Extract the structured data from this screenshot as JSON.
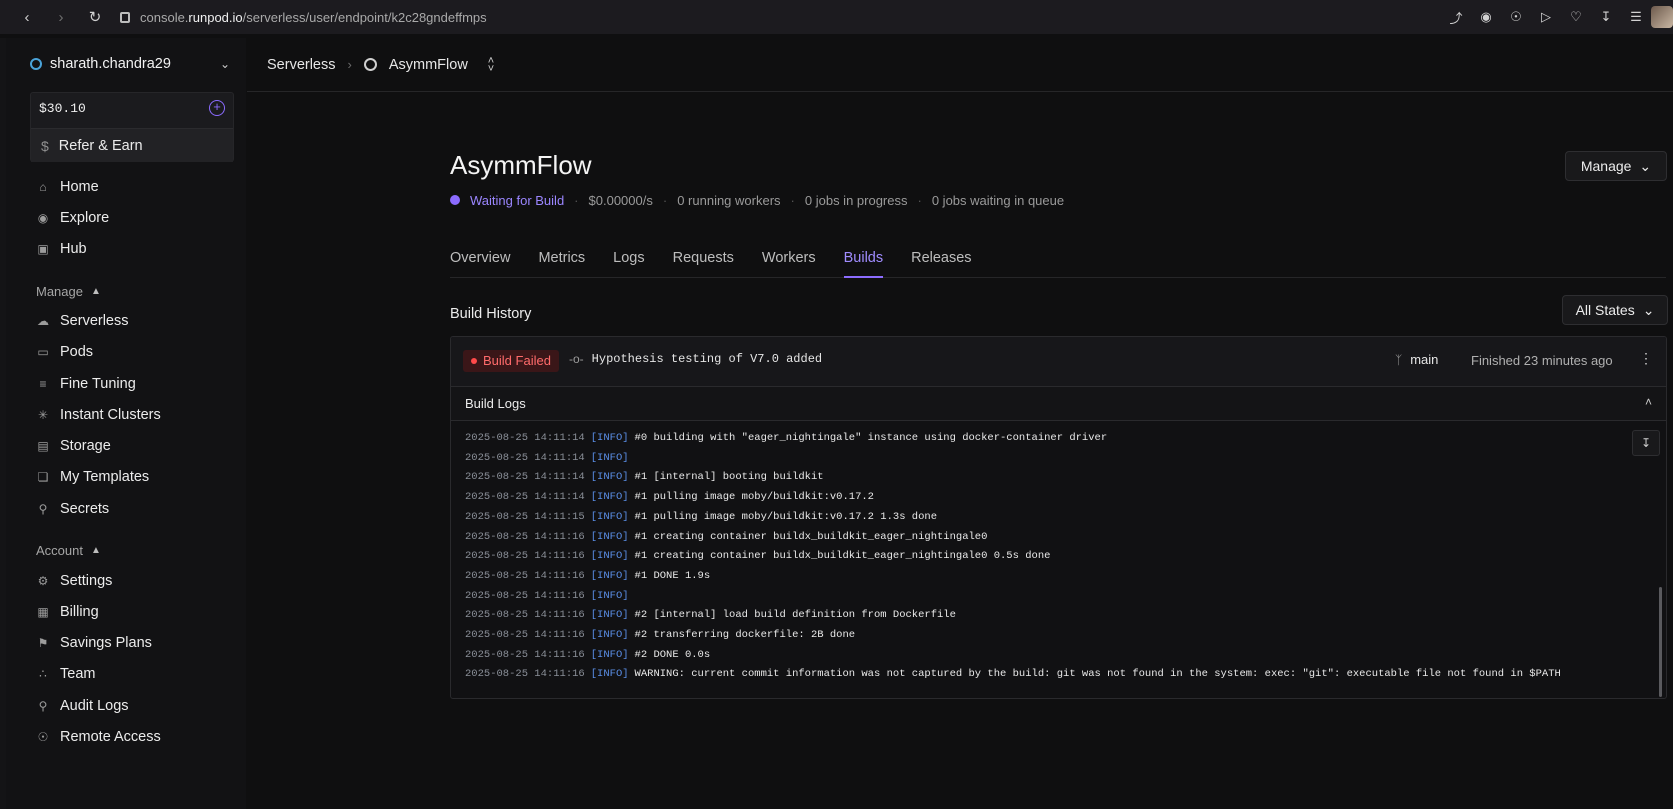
{
  "browser": {
    "url_prefix": "console.",
    "url_host": "runpod.io",
    "url_path": "/serverless/user/endpoint/k2c28gndeffmps"
  },
  "sidebar": {
    "account_name": "sharath.chandra29",
    "balance": "$30.10",
    "refer_label": "Refer & Earn",
    "top_items": [
      {
        "label": "Home",
        "icon": "home-icon"
      },
      {
        "label": "Explore",
        "icon": "compass-icon"
      },
      {
        "label": "Hub",
        "icon": "store-icon"
      }
    ],
    "manage_label": "Manage",
    "manage_items": [
      {
        "label": "Serverless",
        "icon": "cloud-icon"
      },
      {
        "label": "Pods",
        "icon": "monitor-icon"
      },
      {
        "label": "Fine Tuning",
        "icon": "sliders-icon"
      },
      {
        "label": "Instant Clusters",
        "icon": "cluster-icon"
      },
      {
        "label": "Storage",
        "icon": "storage-icon"
      },
      {
        "label": "My Templates",
        "icon": "template-icon"
      },
      {
        "label": "Secrets",
        "icon": "key-icon"
      }
    ],
    "account_label": "Account",
    "account_items": [
      {
        "label": "Settings",
        "icon": "gear-icon"
      },
      {
        "label": "Billing",
        "icon": "billing-icon"
      },
      {
        "label": "Savings Plans",
        "icon": "tag-icon"
      },
      {
        "label": "Team",
        "icon": "team-icon"
      },
      {
        "label": "Audit Logs",
        "icon": "audit-icon"
      },
      {
        "label": "Remote Access",
        "icon": "remote-icon"
      }
    ]
  },
  "breadcrumb": {
    "root": "Serverless",
    "endpoint": "AsymmFlow"
  },
  "endpoint": {
    "title": "AsymmFlow",
    "status": "Waiting for Build",
    "rate": "$0.00000/s",
    "workers": "0 running workers",
    "jobs_progress": "0 jobs in progress",
    "jobs_queue": "0 jobs waiting in queue",
    "manage_label": "Manage"
  },
  "tabs": [
    "Overview",
    "Metrics",
    "Logs",
    "Requests",
    "Workers",
    "Builds",
    "Releases"
  ],
  "active_tab": "Builds",
  "build_history": {
    "title": "Build History",
    "filter": "All States",
    "build": {
      "status": "Build Failed",
      "commit": "Hypothesis testing of V7.0 added",
      "branch": "main",
      "finished": "Finished 23 minutes ago"
    },
    "logs_label": "Build Logs",
    "logs": [
      {
        "ts": "2025-08-25 14:11:14",
        "lv": "[INFO]",
        "msg": "#0 building with \"eager_nightingale\" instance using docker-container driver"
      },
      {
        "ts": "2025-08-25 14:11:14",
        "lv": "[INFO]",
        "msg": ""
      },
      {
        "ts": "2025-08-25 14:11:14",
        "lv": "[INFO]",
        "msg": "#1 [internal] booting buildkit"
      },
      {
        "ts": "2025-08-25 14:11:14",
        "lv": "[INFO]",
        "msg": "#1 pulling image moby/buildkit:v0.17.2"
      },
      {
        "ts": "2025-08-25 14:11:15",
        "lv": "[INFO]",
        "msg": "#1 pulling image moby/buildkit:v0.17.2 1.3s done"
      },
      {
        "ts": "2025-08-25 14:11:16",
        "lv": "[INFO]",
        "msg": "#1 creating container buildx_buildkit_eager_nightingale0"
      },
      {
        "ts": "2025-08-25 14:11:16",
        "lv": "[INFO]",
        "msg": "#1 creating container buildx_buildkit_eager_nightingale0 0.5s done"
      },
      {
        "ts": "2025-08-25 14:11:16",
        "lv": "[INFO]",
        "msg": "#1 DONE 1.9s"
      },
      {
        "ts": "2025-08-25 14:11:16",
        "lv": "[INFO]",
        "msg": ""
      },
      {
        "ts": "2025-08-25 14:11:16",
        "lv": "[INFO]",
        "msg": "#2 [internal] load build definition from Dockerfile"
      },
      {
        "ts": "2025-08-25 14:11:16",
        "lv": "[INFO]",
        "msg": "#2 transferring dockerfile: 2B done"
      },
      {
        "ts": "2025-08-25 14:11:16",
        "lv": "[INFO]",
        "msg": "#2 DONE 0.0s"
      },
      {
        "ts": "2025-08-25 14:11:16",
        "lv": "[INFO]",
        "msg": "WARNING: current commit information was not captured by the build: git was not found in the system: exec: \"git\": executable file not found in $PATH"
      }
    ]
  }
}
